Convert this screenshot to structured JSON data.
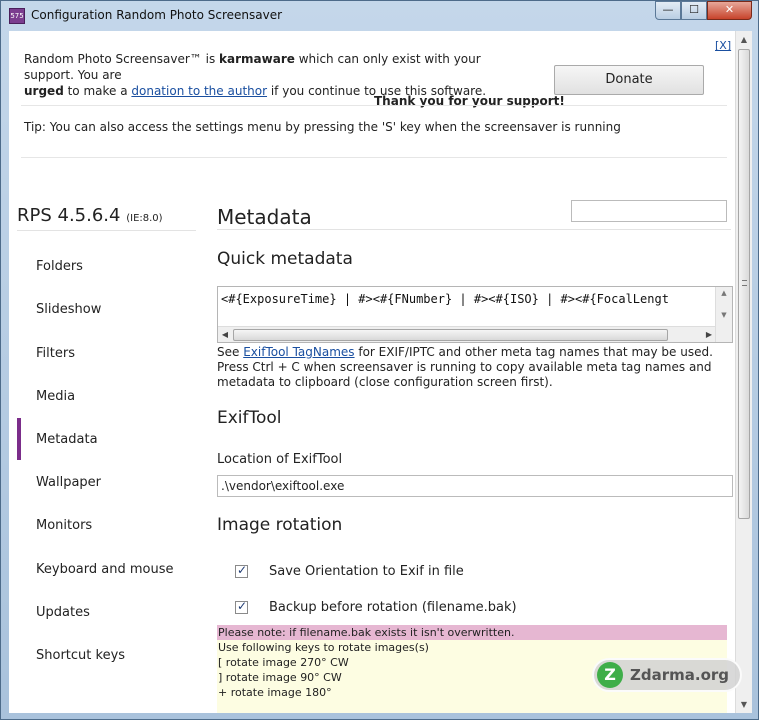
{
  "window": {
    "title": "Configuration Random Photo Screensaver",
    "icon_text": "575",
    "buttons": {
      "minimize": "—",
      "maximize": "☐",
      "close": "✕"
    }
  },
  "banner": {
    "close_link": "[X]",
    "line1_pre": "Random Photo Screensaver™ is ",
    "line1_bold": "karmaware",
    "line1_post": " which can only exist with your support. You are",
    "line2_bold": "urged",
    "line2_pre": " to make a ",
    "donation_link": "donation to the author",
    "line2_post": " if you continue to use this software.",
    "donate_label": "Donate",
    "thanks": "Thank you for your support!",
    "tip": "Tip: You can also access the settings menu by pressing the 'S' key when the screensaver is running"
  },
  "sidebar": {
    "version": "RPS 4.5.6.4",
    "version_ie": "(IE:8.0)",
    "items": [
      {
        "label": "Folders"
      },
      {
        "label": "Slideshow"
      },
      {
        "label": "Filters"
      },
      {
        "label": "Media"
      },
      {
        "label": "Metadata"
      },
      {
        "label": "Wallpaper"
      },
      {
        "label": "Monitors"
      },
      {
        "label": "Keyboard and mouse"
      },
      {
        "label": "Updates"
      },
      {
        "label": "Shortcut keys"
      }
    ],
    "active_index": 4
  },
  "main": {
    "title": "Metadata",
    "search_value": "",
    "quick_metadata": {
      "heading": "Quick metadata",
      "value": "<#{ExposureTime} | #><#{FNumber} | #><#{ISO} | #><#{FocalLengt",
      "help_pre": "See ",
      "help_link": "ExifTool TagNames",
      "help_post": " for EXIF/IPTC and other meta tag names that may be used.",
      "help_line2": "Press Ctrl + C when screensaver is running to copy available meta tag names and metadata to clipboard (close configuration screen first)."
    },
    "exiftool": {
      "heading": "ExifTool",
      "location_label": "Location of ExifTool",
      "location_value": ".\\vendor\\exiftool.exe"
    },
    "image_rotation": {
      "heading": "Image rotation",
      "checkboxes": [
        {
          "label": "Save Orientation to Exif in file",
          "checked": true
        },
        {
          "label": "Backup before rotation (filename.bak)",
          "checked": true
        }
      ],
      "note": "Please note: if filename.bak exists it isn't overwritten.",
      "keys_intro": "Use following keys to rotate images(s)",
      "keys": [
        "[ rotate image 270° CW",
        "] rotate image 90° CW",
        "+ rotate image 180°"
      ]
    }
  },
  "watermark": {
    "logo": "Z",
    "text": "Zdarma.org"
  }
}
